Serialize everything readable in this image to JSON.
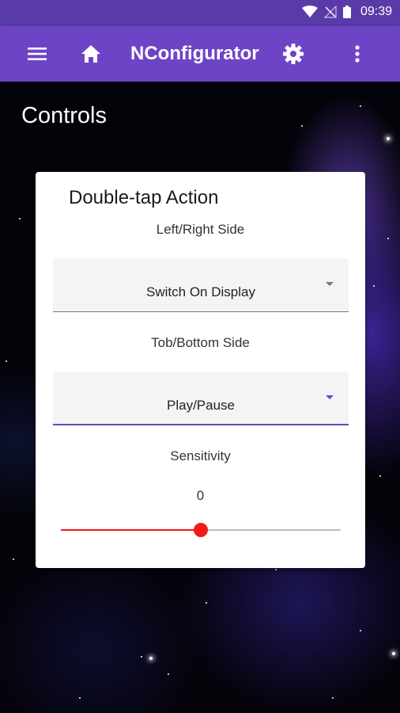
{
  "status_bar": {
    "time": "09:39"
  },
  "app_bar": {
    "title": "NConfigurator"
  },
  "page": {
    "heading": "Controls"
  },
  "card": {
    "title": "Double-tap Action",
    "left_right": {
      "label": "Left/Right Side",
      "selected": "Switch On Display"
    },
    "top_bottom": {
      "label": "Tob/Bottom Side",
      "selected": "Play/Pause"
    },
    "sensitivity": {
      "label": "Sensitivity",
      "value": "0",
      "level": 0.5
    }
  },
  "colors": {
    "status_bar": "#5a3aa8",
    "app_bar": "#6d44c6",
    "accent": "#6d44c6",
    "slider": "#f21b1b"
  }
}
